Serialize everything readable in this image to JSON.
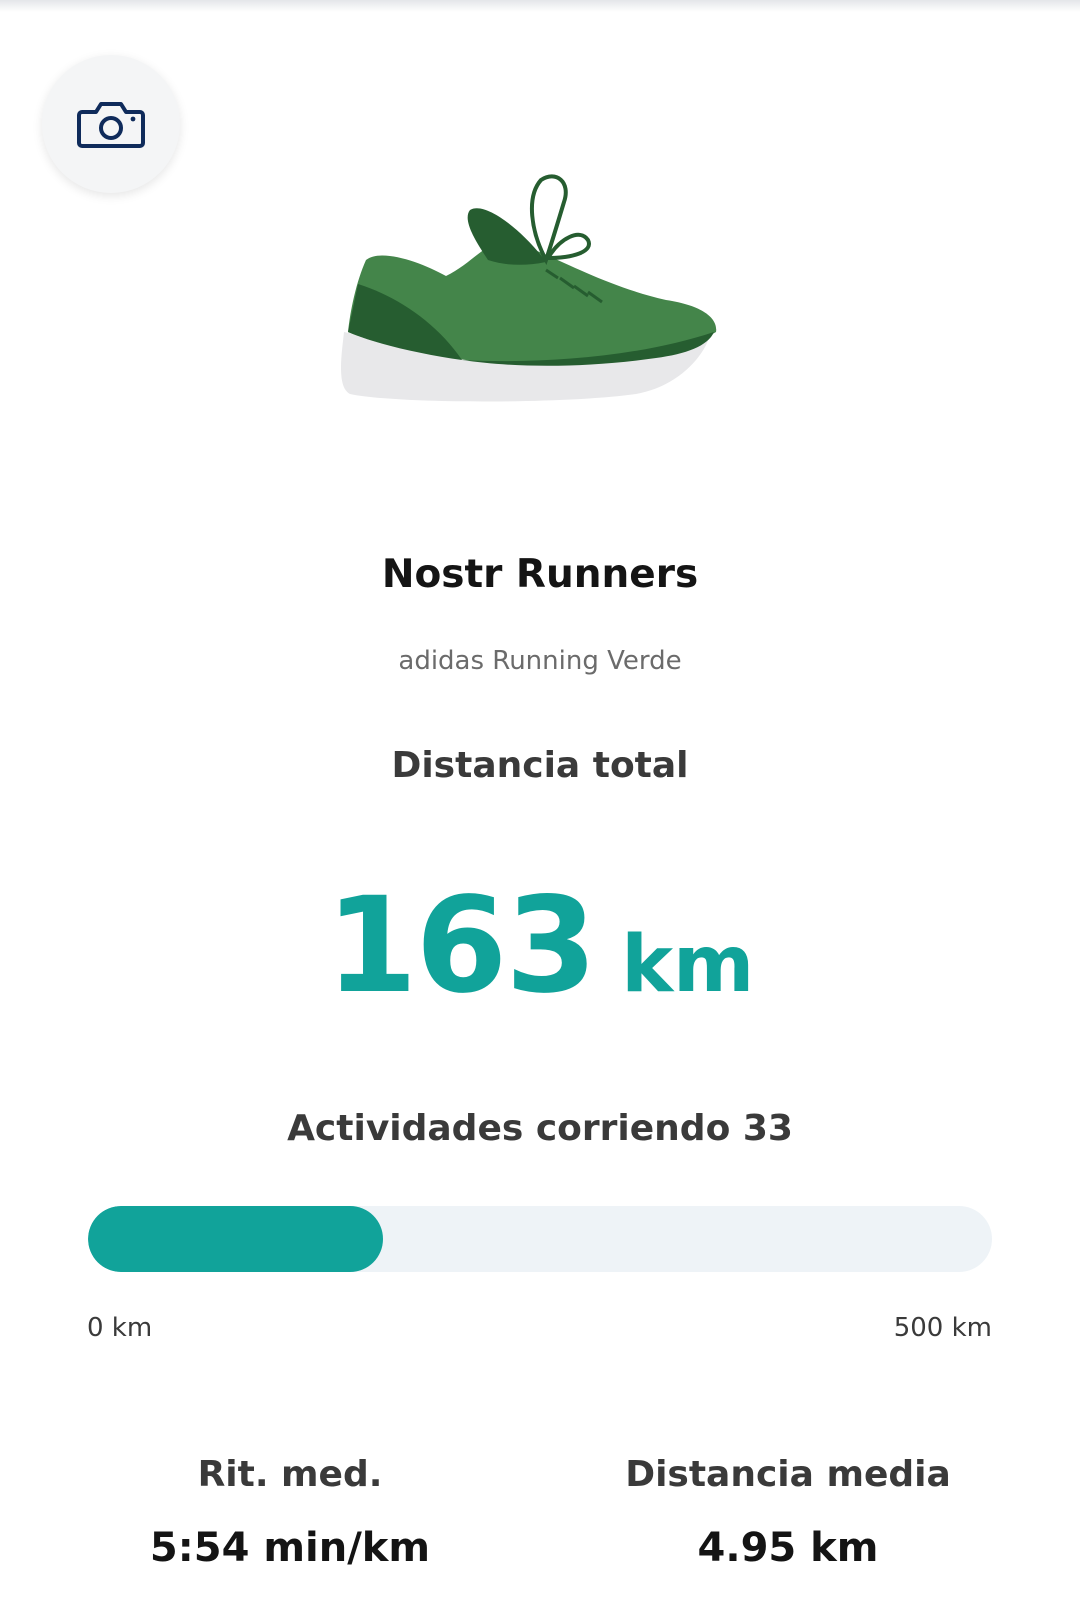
{
  "header": {
    "camera_icon": "camera-icon"
  },
  "shoe": {
    "name": "Nostr Runners",
    "model": "adidas Running Verde",
    "image_icon": "running-shoe-illustration"
  },
  "total_distance": {
    "label": "Distancia total",
    "value": "163",
    "unit": "km"
  },
  "activities": {
    "label": "Actividades corriendo 33"
  },
  "progress": {
    "current_km": 163,
    "max_km": 500,
    "fraction": 0.326,
    "min_label": "0 km",
    "max_label": "500 km"
  },
  "stats": {
    "pace_label": "Rit. med.",
    "pace_value": "5:54 min/km",
    "avg_distance_label": "Distancia media",
    "avg_distance_value": "4.95 km"
  },
  "colors": {
    "accent": "#11a39a",
    "track": "#eef3f7",
    "shoe_green": "#44854a",
    "shoe_dark_green": "#265d30",
    "sole": "#e8e8ea",
    "camera_icon": "#0f2b5b"
  }
}
